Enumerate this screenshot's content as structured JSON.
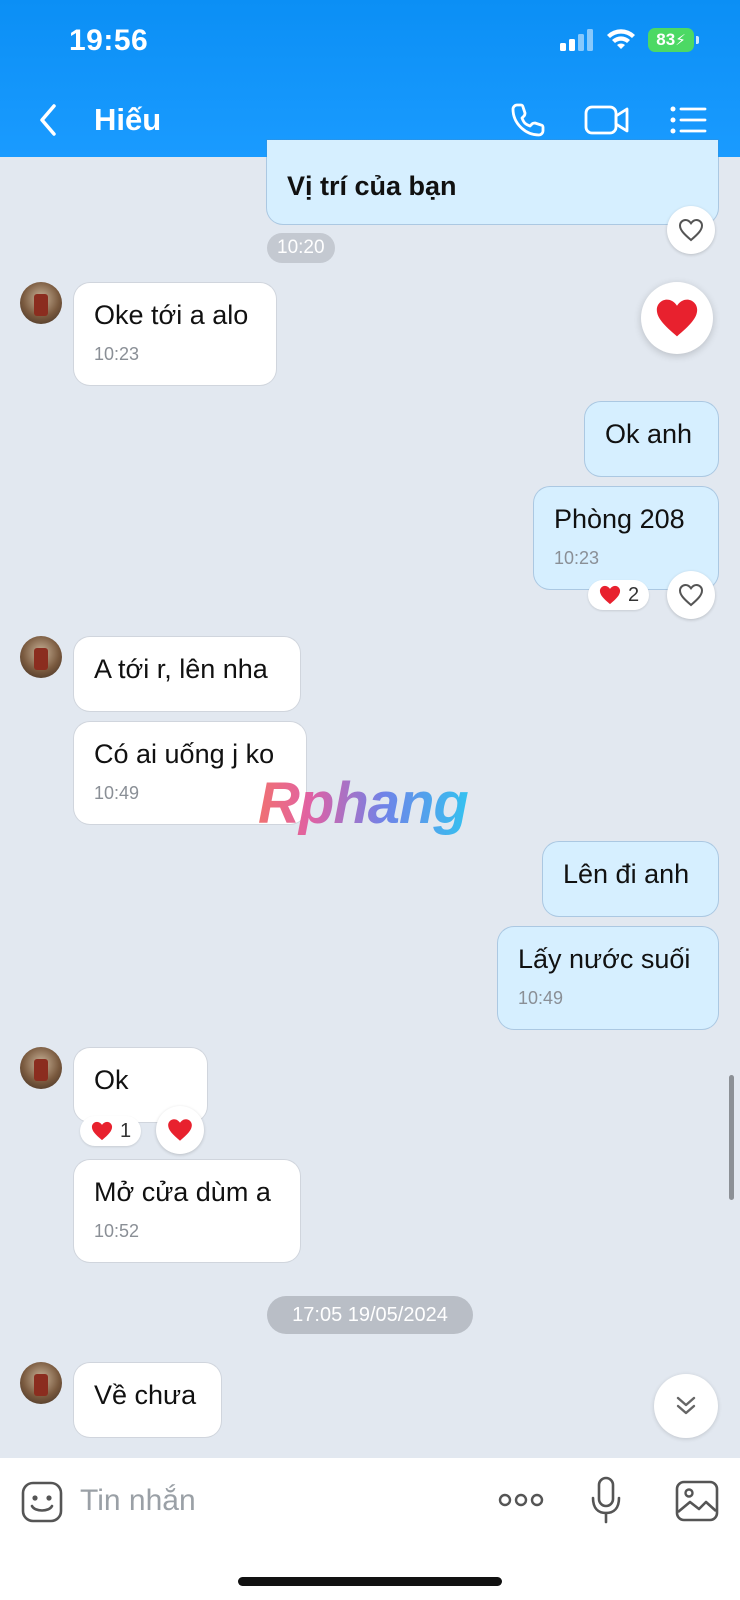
{
  "status": {
    "time": "19:56",
    "battery": "83"
  },
  "nav": {
    "title": "Hiếu"
  },
  "messages": {
    "m0": {
      "text": "Vị trí của bạn",
      "time": "10:20"
    },
    "m1": {
      "text": "Oke tới a alo",
      "time": "10:23"
    },
    "m2": {
      "text": "Ok anh"
    },
    "m3": {
      "text": "Phòng 208",
      "time": "10:23",
      "reaction_count": "2"
    },
    "m4": {
      "text": "A tới r, lên nha"
    },
    "m5": {
      "text": "Có ai uống j ko",
      "time": "10:49"
    },
    "m6": {
      "text": "Lên đi anh"
    },
    "m7": {
      "text": "Lấy nước suối",
      "time": "10:49"
    },
    "m8": {
      "text": "Ok",
      "reaction_count": "1"
    },
    "m9": {
      "text": "Mở cửa dùm a",
      "time": "10:52"
    },
    "m10": {
      "text": "Về chưa"
    }
  },
  "date_separator": "17:05 19/05/2024",
  "watermark": "Rphang",
  "composer": {
    "placeholder": "Tin nhắn"
  },
  "colors": {
    "header": "#0b8ff5",
    "outgoing": "#d6efff",
    "incoming": "#ffffff",
    "heart": "#e8212e",
    "background": "#e2e8f0"
  }
}
